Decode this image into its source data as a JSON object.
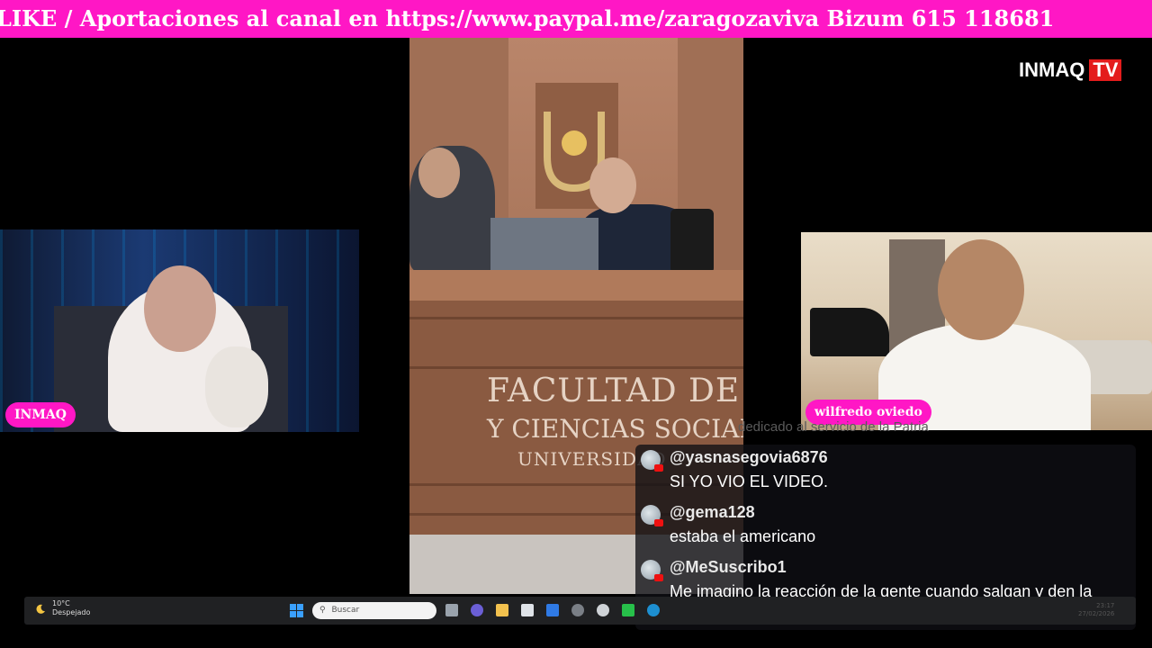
{
  "ticker": {
    "text": "LIKE / Aportaciones al canal en https://www.paypal.me/zaragozaviva Bizum 615 118681"
  },
  "logo": {
    "brand": "INMAQ",
    "suffix": "TV"
  },
  "stage": {
    "facade_line1": "FACULTAD DE",
    "facade_line2": "Y CIENCIAS SOCIAL",
    "facade_line3": "UNIVERSIDAD"
  },
  "cams": {
    "left_name": "INMAQ",
    "right_name": "wilfredo oviedo"
  },
  "chat": {
    "faded_text": "dedicado al servicio de la Patria",
    "messages": [
      {
        "author": "@yasnasegovia6876",
        "text": "SI YO VIO EL VIDEO."
      },
      {
        "author": "@gema128",
        "text": "estaba el americano"
      },
      {
        "author": "@MeSuscribo1",
        "text": "Me imagino la reacción de la gente cuando salgan y den la cara... Repudio total"
      }
    ]
  },
  "taskbar": {
    "temperature": "10°C",
    "weather": "Despejado",
    "search_placeholder": "Buscar",
    "time": "23:17",
    "date": "27/02/2026"
  },
  "colors": {
    "accent": "#ff17c5",
    "logo_red": "#e41c1c"
  }
}
